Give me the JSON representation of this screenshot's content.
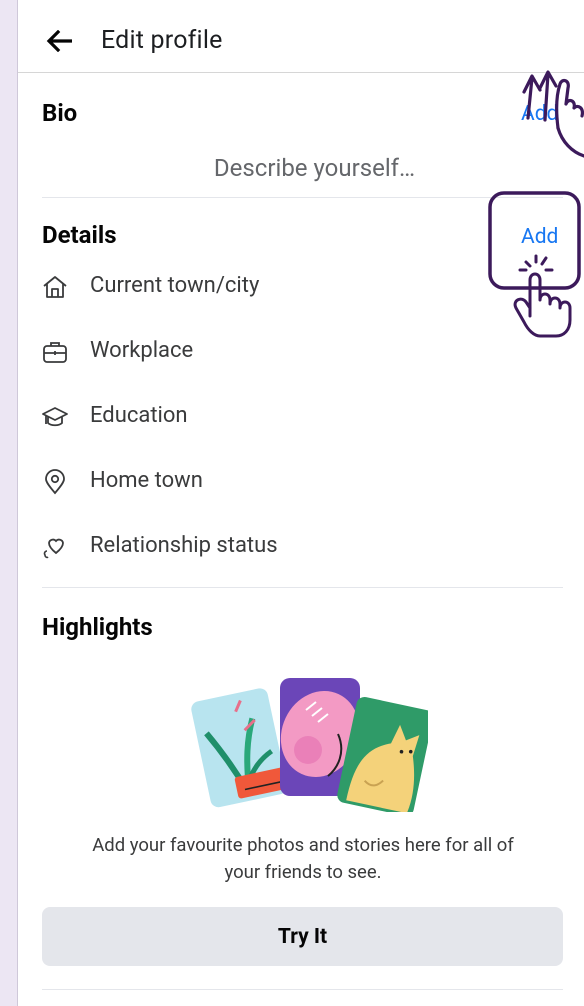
{
  "header": {
    "title": "Edit profile",
    "back_icon": "arrow-left-icon"
  },
  "bio": {
    "title": "Bio",
    "add_label": "Add",
    "placeholder": "Describe yourself…"
  },
  "details": {
    "title": "Details",
    "add_label": "Add",
    "items": [
      {
        "label": "Current town/city",
        "icon": "home-icon"
      },
      {
        "label": "Workplace",
        "icon": "briefcase-icon"
      },
      {
        "label": "Education",
        "icon": "graduation-cap-icon"
      },
      {
        "label": "Home town",
        "icon": "location-pin-icon"
      },
      {
        "label": "Relationship status",
        "icon": "hearts-icon"
      }
    ]
  },
  "highlights": {
    "title": "Highlights",
    "caption_line1": "Add your favourite photos and stories here for all of",
    "caption_line2": "your friends to see.",
    "button_label": "Try It"
  },
  "colors": {
    "accent": "#1877f2",
    "annotation": "#3c1a5b",
    "background": "#ece6f3"
  }
}
